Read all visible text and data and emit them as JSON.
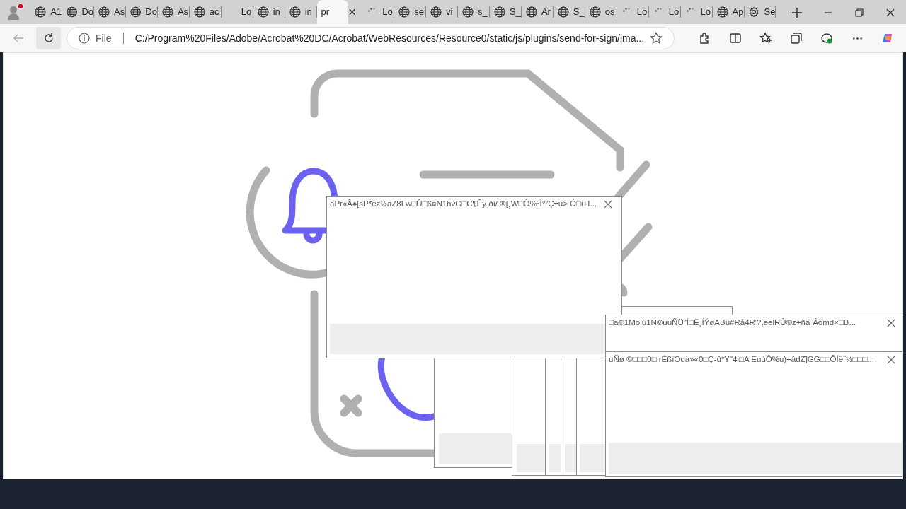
{
  "tabs": [
    {
      "label": "A1",
      "kind": "globe",
      "selected": false
    },
    {
      "label": "Do",
      "kind": "globe",
      "selected": false
    },
    {
      "label": "As",
      "kind": "globe",
      "selected": false
    },
    {
      "label": "Do",
      "kind": "globe",
      "selected": false
    },
    {
      "label": "As",
      "kind": "globe",
      "selected": false
    },
    {
      "label": "ac",
      "kind": "globe",
      "selected": false
    },
    {
      "label": "Lo",
      "kind": "blank",
      "selected": false
    },
    {
      "label": "in",
      "kind": "globe",
      "selected": false
    },
    {
      "label": "in",
      "kind": "globe",
      "selected": false
    },
    {
      "label": "pr",
      "kind": "blank",
      "selected": true
    },
    {
      "label": "Lo",
      "kind": "loading",
      "selected": false
    },
    {
      "label": "se",
      "kind": "globe",
      "selected": false
    },
    {
      "label": "vi",
      "kind": "globe",
      "selected": false
    },
    {
      "label": "s_",
      "kind": "globe",
      "selected": false
    },
    {
      "label": "S_",
      "kind": "globe",
      "selected": false
    },
    {
      "label": "Ar",
      "kind": "globe",
      "selected": false
    },
    {
      "label": "S_",
      "kind": "globe",
      "selected": false
    },
    {
      "label": "os",
      "kind": "globe",
      "selected": false
    },
    {
      "label": "Lo",
      "kind": "loading",
      "selected": false
    },
    {
      "label": "Lo",
      "kind": "loading",
      "selected": false
    },
    {
      "label": "Lo",
      "kind": "loading",
      "selected": false
    },
    {
      "label": "Ap",
      "kind": "globe",
      "selected": false
    },
    {
      "label": "Se",
      "kind": "settings",
      "selected": false
    }
  ],
  "address_bar": {
    "scheme": "File",
    "url": "C:/Program%20Files/Adobe/Acrobat%20DC/Acrobat/WebResources/Resource0/static/js/plugins/send-for-sign/ima..."
  },
  "popups": [
    {
      "kind": "frame"
    },
    {
      "kind": "frame"
    },
    {
      "kind": "frame"
    },
    {
      "kind": "frame"
    },
    {
      "kind": "frame"
    },
    {
      "kind": "frame"
    },
    {
      "kind": "dialog",
      "title": "âPr«Â♠[sP*ez½ãZ8Lw□Û□6¤N1hvG□C¶Êÿ ðí/ ®[¸W□Ò%²Ì°²Ç±ù> Ó□i+I..."
    },
    {
      "kind": "dialog",
      "title": "□ã©1Molú1N©uüÑÜ\"Í□Ë¸ÍÝøABü#Rå4R'?,eelRÙ©z+ñä¨Âõmd×□B..."
    },
    {
      "kind": "dialog",
      "title": "uÑø ©□□□0□ rÉßïOdà»«0□Ç-û*Y\"4i□A EuúÔ%u)+âdZ]GG□□ÔÍë˝½□□□..."
    }
  ]
}
